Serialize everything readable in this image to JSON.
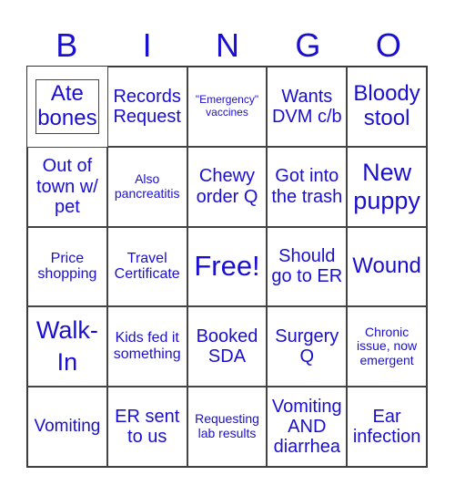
{
  "header": {
    "letters": [
      "B",
      "I",
      "N",
      "G",
      "O"
    ]
  },
  "colors": {
    "text": "#1a0fd0",
    "border": "#444444"
  },
  "cells": [
    [
      "Ate bones",
      "Records Request",
      "\"Emergency\" vaccines",
      "Wants DVM c/b",
      "Bloody stool"
    ],
    [
      "Out of town w/ pet",
      "Also pancreatitis",
      "Chewy order Q",
      "Got into the trash",
      "New puppy"
    ],
    [
      "Price shopping",
      "Travel Certificate",
      "Free!",
      "Should go to ER",
      "Wound"
    ],
    [
      "Walk-In",
      "Kids fed it something",
      "Booked SDA",
      "Surgery Q",
      "Chronic issue, now emergent"
    ],
    [
      "Vomiting",
      "ER sent to us",
      "Requesting lab results",
      "Vomiting AND diarrhea",
      "Ear infection"
    ]
  ]
}
